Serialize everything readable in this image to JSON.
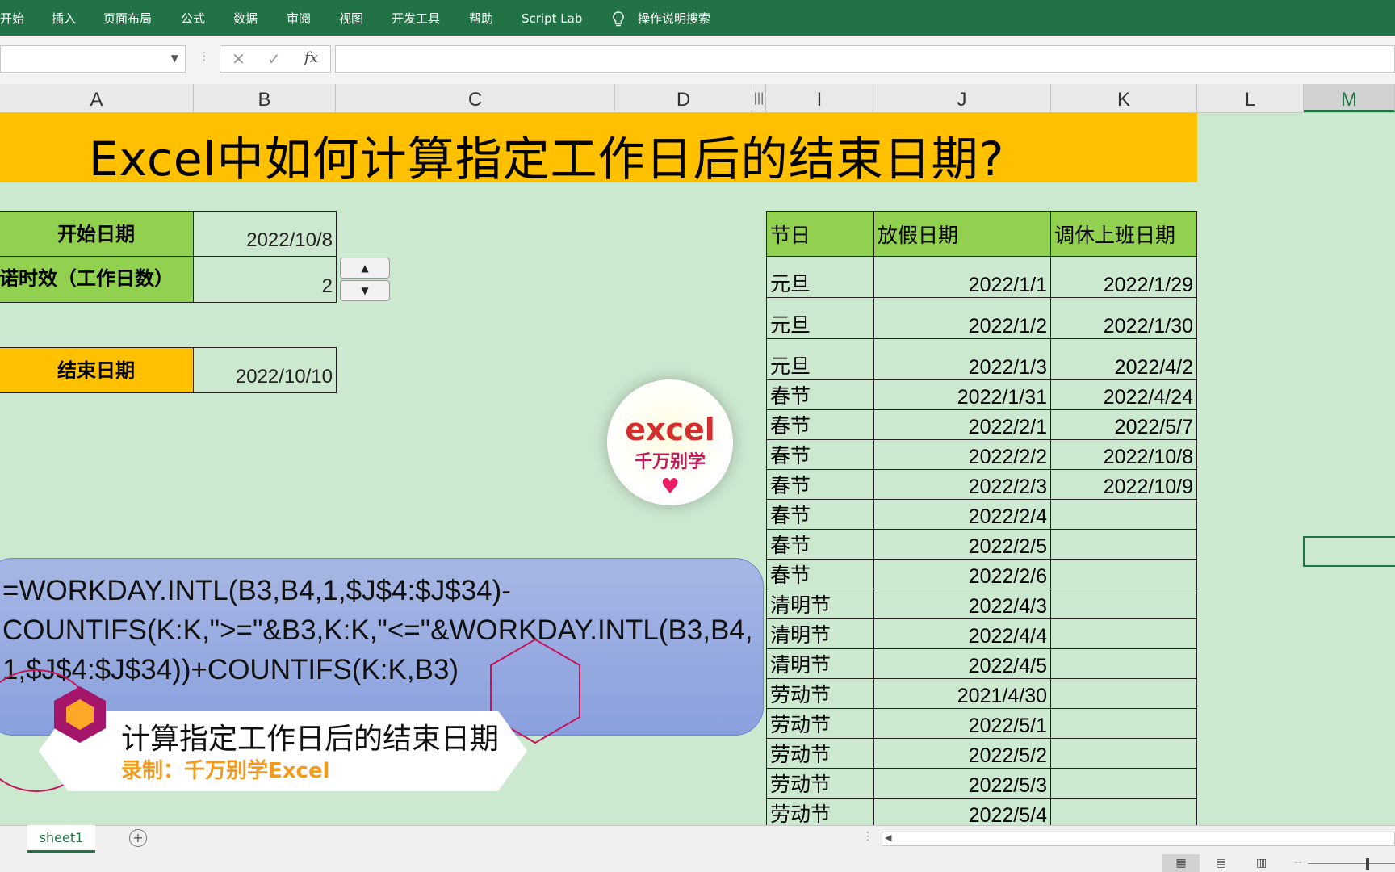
{
  "ribbon": {
    "tabs": [
      "开始",
      "插入",
      "页面布局",
      "公式",
      "数据",
      "审阅",
      "视图",
      "开发工具",
      "帮助",
      "Script Lab"
    ],
    "search_label": "操作说明搜索"
  },
  "formula_bar": {
    "fx_label": "fx",
    "content": ""
  },
  "columns": [
    "A",
    "B",
    "C",
    "D",
    "I",
    "J",
    "K",
    "L",
    "M"
  ],
  "title": "Excel中如何计算指定工作日后的结束日期?",
  "inputs": {
    "start_label": "开始日期",
    "start_value": "2022/10/8",
    "days_label": "诺时效（工作日数）",
    "days_value": "2",
    "end_label": "结束日期",
    "end_value": "2022/10/10"
  },
  "holiday_table": {
    "headers": [
      "节日",
      "放假日期",
      "调休上班日期"
    ],
    "rows": [
      [
        "元旦",
        "2022/1/1",
        "2022/1/29"
      ],
      [
        "元旦",
        "2022/1/2",
        "2022/1/30"
      ],
      [
        "元旦",
        "2022/1/3",
        "2022/4/2"
      ],
      [
        "春节",
        "2022/1/31",
        "2022/4/24"
      ],
      [
        "春节",
        "2022/2/1",
        "2022/5/7"
      ],
      [
        "春节",
        "2022/2/2",
        "2022/10/8"
      ],
      [
        "春节",
        "2022/2/3",
        "2022/10/9"
      ],
      [
        "春节",
        "2022/2/4",
        ""
      ],
      [
        "春节",
        "2022/2/5",
        ""
      ],
      [
        "春节",
        "2022/2/6",
        ""
      ],
      [
        "清明节",
        "2022/4/3",
        ""
      ],
      [
        "清明节",
        "2022/4/4",
        ""
      ],
      [
        "清明节",
        "2022/4/5",
        ""
      ],
      [
        "劳动节",
        "2021/4/30",
        ""
      ],
      [
        "劳动节",
        "2022/5/1",
        ""
      ],
      [
        "劳动节",
        "2022/5/2",
        ""
      ],
      [
        "劳动节",
        "2022/5/3",
        ""
      ],
      [
        "劳动节",
        "2022/5/4",
        ""
      ]
    ]
  },
  "formula_overlay": {
    "line1": "=WORKDAY.INTL(B3,B4,1,$J$4:$J$34)-",
    "line2": "COUNTIFS(K:K,\">=\"&B3,K:K,\"<=\"&WORKDAY.INTL(B3,B4,",
    "line3": "1,$J$4:$J$34))+COUNTIFS(K:K,B3)"
  },
  "caption": {
    "title": "计算指定工作日后的结束日期",
    "subtitle": "录制：千万别学Excel"
  },
  "logo": {
    "word": "excel",
    "sub": "千万别学"
  },
  "sheet_tab": "sheet1",
  "colors": {
    "ribbon": "#217346",
    "title_band": "#ffc000",
    "label_green": "#92d050",
    "grid_bg": "#cce8cf"
  }
}
